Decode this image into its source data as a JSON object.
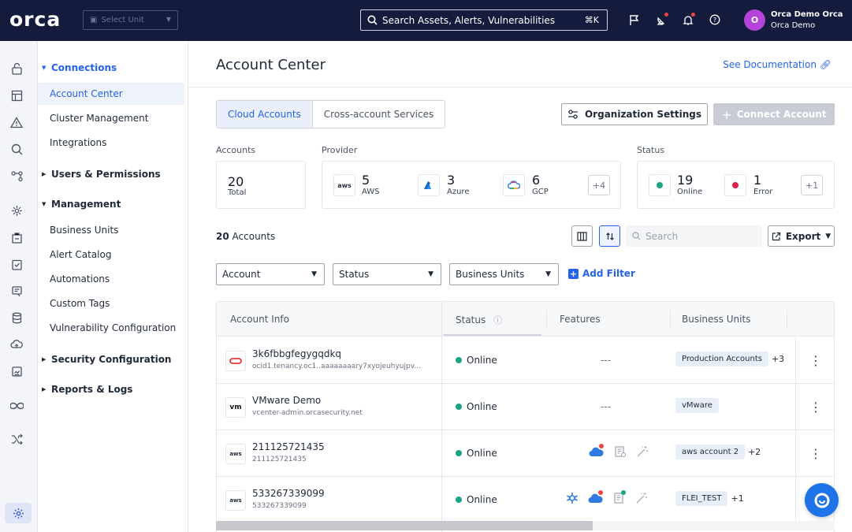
{
  "topbar": {
    "logo": "orca",
    "unit_select_placeholder": "Select Unit",
    "search_placeholder": "Search Assets, Alerts, Vulnerabilities",
    "search_shortcut": "⌘K",
    "avatar_initial": "O",
    "user_name": "Orca Demo Orca",
    "user_org": "Orca Demo"
  },
  "nav": {
    "connections": "Connections",
    "account_center": "Account Center",
    "cluster_management": "Cluster Management",
    "integrations": "Integrations",
    "users_permissions": "Users & Permissions",
    "management": "Management",
    "business_units": "Business Units",
    "alert_catalog": "Alert Catalog",
    "automations": "Automations",
    "custom_tags": "Custom Tags",
    "vulnerability_configuration": "Vulnerability Configuration",
    "security_configuration": "Security Configuration",
    "reports_logs": "Reports & Logs"
  },
  "page": {
    "title": "Account Center",
    "doc_link": "See Documentation"
  },
  "tabs": {
    "cloud_accounts": "Cloud Accounts",
    "cross_account": "Cross-account Services"
  },
  "buttons": {
    "org_settings": "Organization Settings",
    "connect_account": "Connect Account",
    "export": "Export",
    "add_filter": "Add Filter"
  },
  "stats": {
    "accounts_label": "Accounts",
    "provider_label": "Provider",
    "status_label": "Status",
    "total_num": "20",
    "total_label": "Total",
    "aws_num": "5",
    "aws_label": "AWS",
    "azure_num": "3",
    "azure_label": "Azure",
    "gcp_num": "6",
    "gcp_label": "GCP",
    "provider_more": "+4",
    "online_num": "19",
    "online_label": "Online",
    "error_num": "1",
    "error_label": "Error",
    "status_more": "+1"
  },
  "table_tools": {
    "count_num": "20",
    "count_label": "Accounts",
    "search_placeholder": "Search"
  },
  "filters": {
    "account": "Account",
    "status": "Status",
    "business_units": "Business Units"
  },
  "table": {
    "headers": {
      "account_info": "Account Info",
      "status": "Status",
      "features": "Features",
      "business_units": "Business Units"
    },
    "rows": [
      {
        "name": "3k6fbbgfegygqdkq",
        "id": "ocid1.tenancy.oc1..aaaaaaaary7xyojeuhyujpv...",
        "status": "Online",
        "features": "---",
        "bu": "Production Accounts",
        "bu_more": "+3"
      },
      {
        "name": "VMware Demo",
        "id": "vcenter-admin.orcasecurity.net",
        "status": "Online",
        "features": "---",
        "bu": "vMware",
        "bu_more": ""
      },
      {
        "name": "211125721435",
        "id": "211125721435",
        "status": "Online",
        "features": "",
        "bu": "aws account 2",
        "bu_more": "+2"
      },
      {
        "name": "533267339099",
        "id": "533267339099",
        "status": "Online",
        "features": "",
        "bu": "FLEI_TEST",
        "bu_more": "+1"
      }
    ]
  },
  "colors": {
    "accent": "#2563eb",
    "topbar": "#141b3d",
    "online": "#1aa386",
    "error": "#e11d48"
  }
}
